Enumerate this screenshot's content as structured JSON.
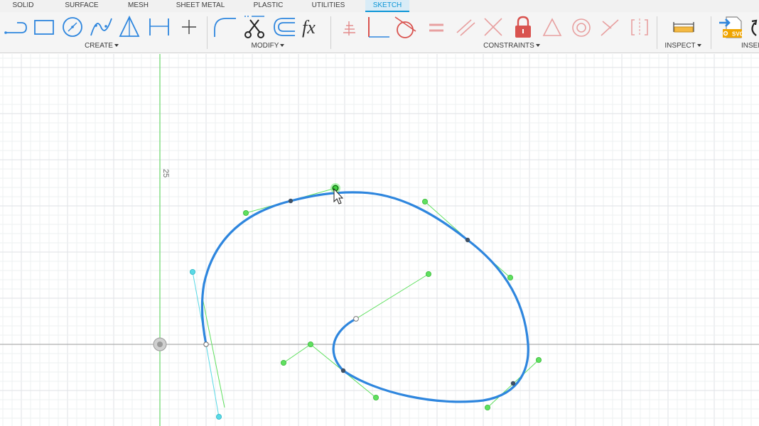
{
  "tabs": [
    {
      "label": "SOLID",
      "active": false
    },
    {
      "label": "SURFACE",
      "active": false
    },
    {
      "label": "MESH",
      "active": false
    },
    {
      "label": "SHEET METAL",
      "active": false
    },
    {
      "label": "PLASTIC",
      "active": false
    },
    {
      "label": "UTILITIES",
      "active": false
    },
    {
      "label": "SKETCH",
      "active": true
    }
  ],
  "groups": {
    "create": "CREATE",
    "modify": "MODIFY",
    "constraints": "CONSTRAINTS",
    "inspect": "INSPECT",
    "insert": "INSER"
  },
  "tools": {
    "create": [
      "line-icon",
      "rectangle-icon",
      "circle-icon",
      "spline-icon",
      "triangle-mirror-icon",
      "dimension-icon",
      "point-icon"
    ],
    "modify": [
      "fillet-icon",
      "trim-scissors-icon",
      "offset-icon",
      "fx-parameters-icon"
    ],
    "constraints": [
      "horizontal-vertical-icon",
      "coincident-icon",
      "tangent-icon",
      "equal-icon",
      "parallel-icon",
      "perpendicular-icon",
      "fix-lock-icon",
      "midpoint-icon",
      "concentric-icon",
      "collinear-icon",
      "symmetric-icon"
    ],
    "inspect": [
      "measure-ruler-icon"
    ],
    "insert": [
      "insert-svg-icon",
      "insert-more-icon"
    ]
  },
  "insert_badge": "SVG",
  "fx_label": "fx",
  "canvas": {
    "axis_tick_label": "25",
    "colors": {
      "grid_minor": "#eef0f2",
      "grid_major": "#dfe2e5",
      "y_axis": "#7ddc7d",
      "x_axis": "#9a9a9a",
      "spline": "#2e86de",
      "handle_green": "#5fe05f",
      "handle_cyan": "#59d9e6",
      "tab_accent": "#0d96d6",
      "lock_red": "#d9534f"
    }
  }
}
